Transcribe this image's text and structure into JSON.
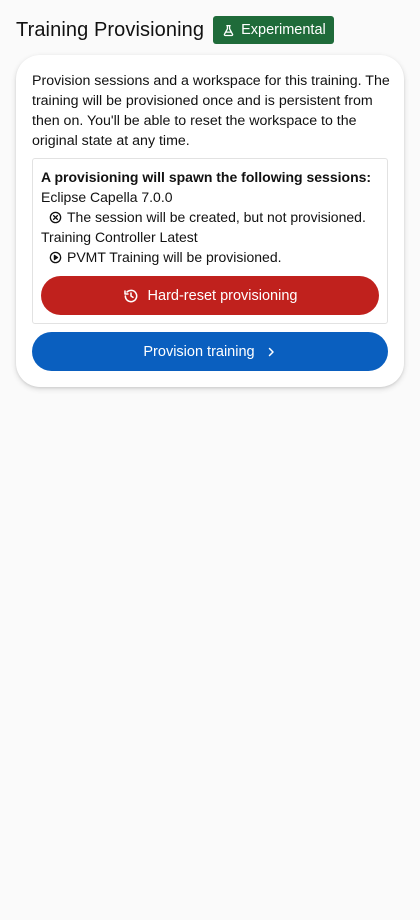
{
  "header": {
    "title": "Training Provisioning",
    "badge": {
      "label": "Experimental",
      "icon": "flask-icon",
      "color": "#1f6b3a"
    }
  },
  "card": {
    "description": "Provision sessions and a workspace for this training. The training will be provisioned once and is persistent from then on. You'll be able to reset the workspace to the original state at any time.",
    "sessions": {
      "heading": "A provisioning will spawn the following sessions:",
      "items": [
        {
          "name": "Eclipse Capella 7.0.0",
          "status_icon": "x-circle-icon",
          "status": "The session will be created, but not provisioned."
        },
        {
          "name": "Training Controller Latest",
          "status_icon": "play-circle-icon",
          "status": "PVMT Training will be provisioned."
        }
      ]
    },
    "hard_reset": {
      "label": "Hard-reset provisioning",
      "icon": "history-icon",
      "color": "#c0211d"
    },
    "provision": {
      "label": "Provision training",
      "icon": "chevron-right-icon",
      "color": "#0a5fbf"
    }
  }
}
